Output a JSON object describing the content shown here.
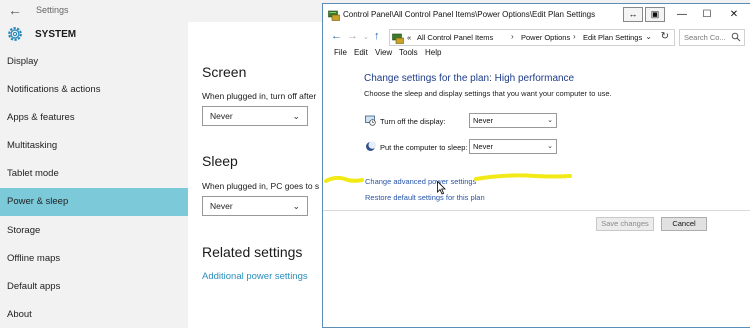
{
  "settings": {
    "window_title": "Settings",
    "header_title": "SYSTEM",
    "nav_items": [
      {
        "label": "Display"
      },
      {
        "label": "Notifications & actions"
      },
      {
        "label": "Apps & features"
      },
      {
        "label": "Multitasking"
      },
      {
        "label": "Tablet mode"
      },
      {
        "label": "Power & sleep",
        "selected": true
      },
      {
        "label": "Storage"
      },
      {
        "label": "Offline maps"
      },
      {
        "label": "Default apps"
      },
      {
        "label": "About"
      }
    ],
    "screen": {
      "title": "Screen",
      "plugged_label": "When plugged in, turn off after",
      "value": "Never"
    },
    "sleep": {
      "title": "Sleep",
      "plugged_label": "When plugged in, PC goes to s",
      "value": "Never"
    },
    "related": {
      "title": "Related settings",
      "link": "Additional power settings"
    },
    "colors": {
      "selected_nav": "#7cc9da",
      "link": "#2a8fbd"
    }
  },
  "control_panel": {
    "title": "Control Panel\\All Control Panel Items\\Power Options\\Edit Plan Settings",
    "breadcrumb": {
      "overflow": "«",
      "items": [
        "All Control Panel Items",
        "Power Options",
        "Edit Plan Settings"
      ]
    },
    "search_placeholder": "Search Co...",
    "menu": [
      "File",
      "Edit",
      "View",
      "Tools",
      "Help"
    ],
    "plan_title": "Change settings for the plan: High performance",
    "plan_subtitle": "Choose the sleep and display settings that you want your computer to use.",
    "display_label": "Turn off the display:",
    "display_value": "Never",
    "sleep_label": "Put the computer to sleep:",
    "sleep_value": "Never",
    "advanced_link": "Change advanced power settings",
    "restore_link": "Restore default settings for this plan",
    "save_button": "Save changes",
    "cancel_button": "Cancel",
    "colors": {
      "title": "#1e3c8a",
      "link": "#2755a8",
      "highlight": "#f2ea16"
    }
  }
}
